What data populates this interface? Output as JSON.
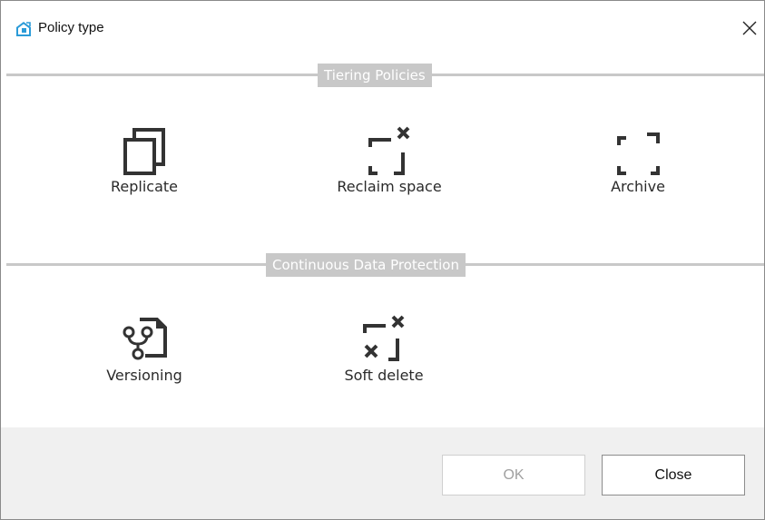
{
  "dialog": {
    "title": "Policy type",
    "close_icon": "close-icon",
    "app_icon": "policy-app-icon"
  },
  "sections": [
    {
      "label": "Tiering Policies",
      "items": [
        {
          "label": "Replicate",
          "icon": "replicate-icon"
        },
        {
          "label": "Reclaim space",
          "icon": "reclaim-space-icon"
        },
        {
          "label": "Archive",
          "icon": "archive-icon"
        }
      ]
    },
    {
      "label": "Continuous Data Protection",
      "items": [
        {
          "label": "Versioning",
          "icon": "versioning-icon"
        },
        {
          "label": "Soft delete",
          "icon": "soft-delete-icon"
        }
      ]
    }
  ],
  "buttons": {
    "ok": "OK",
    "close": "Close"
  },
  "colors": {
    "section_bar": "#c8c8c8",
    "footer_bg": "#f0f0f0",
    "icon_blue": "#2b9bd8"
  }
}
